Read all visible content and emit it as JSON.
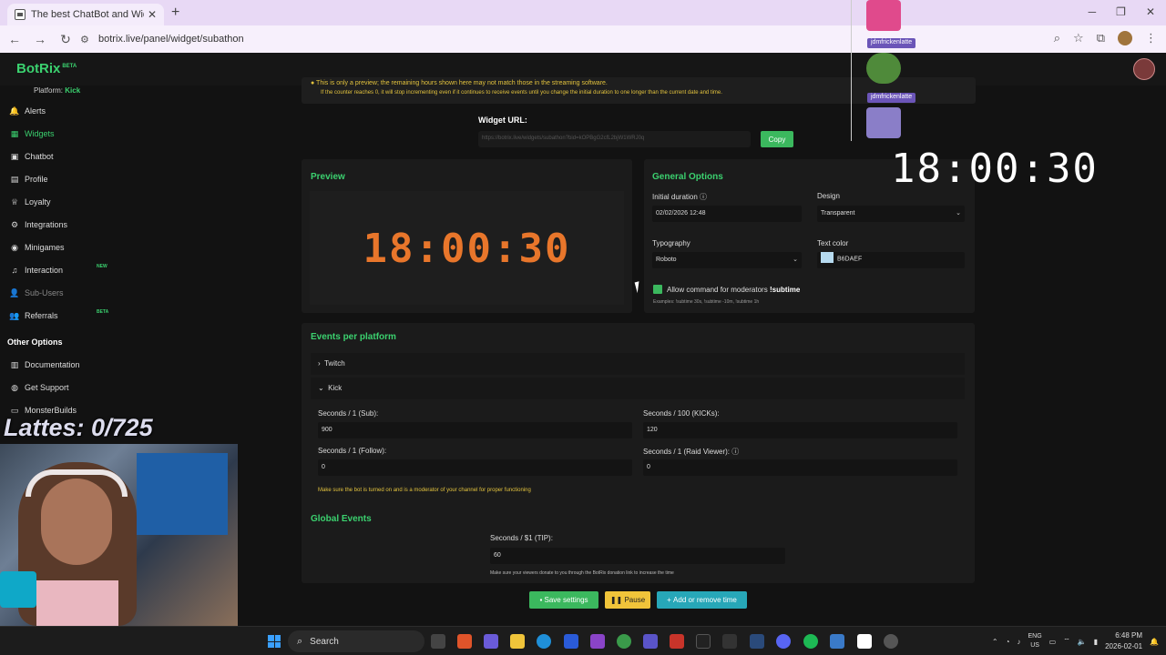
{
  "browser": {
    "tab_title": "The best ChatBot and Widgets",
    "url": "botrix.live/panel/widget/subathon"
  },
  "app": {
    "logo": "BotRix",
    "logo_badge": "BETA",
    "platform_label": "Platform:",
    "platform_value": "Kick"
  },
  "sidebar": {
    "items": [
      {
        "label": "Alerts",
        "icon": "bell-icon"
      },
      {
        "label": "Widgets",
        "icon": "grid-icon"
      },
      {
        "label": "Chatbot",
        "icon": "robot-icon"
      },
      {
        "label": "Profile",
        "icon": "id-card-icon"
      },
      {
        "label": "Loyalty",
        "icon": "trophy-icon"
      },
      {
        "label": "Integrations",
        "icon": "plug-icon"
      },
      {
        "label": "Minigames",
        "icon": "gamepad-icon"
      },
      {
        "label": "Interaction",
        "icon": "music-icon"
      },
      {
        "label": "Sub-Users",
        "icon": "users-icon"
      },
      {
        "label": "Referrals",
        "icon": "group-icon"
      }
    ],
    "badge_new": "NEW",
    "badge_beta": "BETA",
    "other_heading": "Other Options",
    "other_items": [
      {
        "label": "Documentation",
        "icon": "book-icon"
      },
      {
        "label": "Get Support",
        "icon": "support-icon"
      },
      {
        "label": "MonsterBuilds",
        "icon": "monitor-icon"
      }
    ]
  },
  "notice": {
    "line1": "This is only a preview; the remaining hours shown here may not match those in the streaming software.",
    "line2": "If the counter reaches 0, it will stop incrementing even if it continues to receive events until you change the initial duration to one longer than the current date and time."
  },
  "widget_url": {
    "label": "Widget URL:",
    "value": "https://botrix.live/widgets/subathon?bid=kOPBgG2cfL2bjW1WRJ0q",
    "copy_label": "Copy"
  },
  "preview": {
    "title": "Preview",
    "timer": "18:00:30"
  },
  "general": {
    "title": "General Options",
    "initial_duration_label": "Initial duration",
    "initial_duration_value": "02/02/2026 12:48",
    "design_label": "Design",
    "design_value": "Transparent",
    "typography_label": "Typography",
    "typography_value": "Roboto",
    "text_color_label": "Text color",
    "text_color_value": "B6DAEF",
    "allow_label": "Allow command for moderators",
    "allow_command": "!subtime",
    "examples": "Examples: !subtime 30s, !subtime -10m, !subtime 1h"
  },
  "events": {
    "title": "Events per platform",
    "twitch_label": "Twitch",
    "kick_label": "Kick",
    "sub_label": "Seconds / 1 (Sub):",
    "sub_value": "900",
    "kicks_label": "Seconds / 100 (KICKs):",
    "kicks_value": "120",
    "follow_label": "Seconds / 1 (Follow):",
    "follow_value": "0",
    "raid_label": "Seconds / 1 (Raid Viewer):",
    "raid_value": "0",
    "bot_hint": "Make sure the bot is turned on and is a moderator of your channel for proper functioning"
  },
  "global": {
    "title": "Global Events",
    "tip_label": "Seconds / $1 (TIP):",
    "tip_value": "60",
    "tip_hint": "Make sure your viewers donate to you through the BotRix donation link to increase the time"
  },
  "actions": {
    "save": "Save settings",
    "pause": "Pause",
    "add": "Add or remove time"
  },
  "overlay": {
    "big_timer": "18:00:30",
    "lattes": "Lattes: 0/725",
    "emote_user_1": "jdmfrickenlatte",
    "emote_user_2": "jdmfrickenlatte"
  },
  "taskbar": {
    "search": "Search",
    "lang1": "ENG",
    "lang2": "US",
    "time": "6:48 PM",
    "date": "2026-02-01"
  }
}
